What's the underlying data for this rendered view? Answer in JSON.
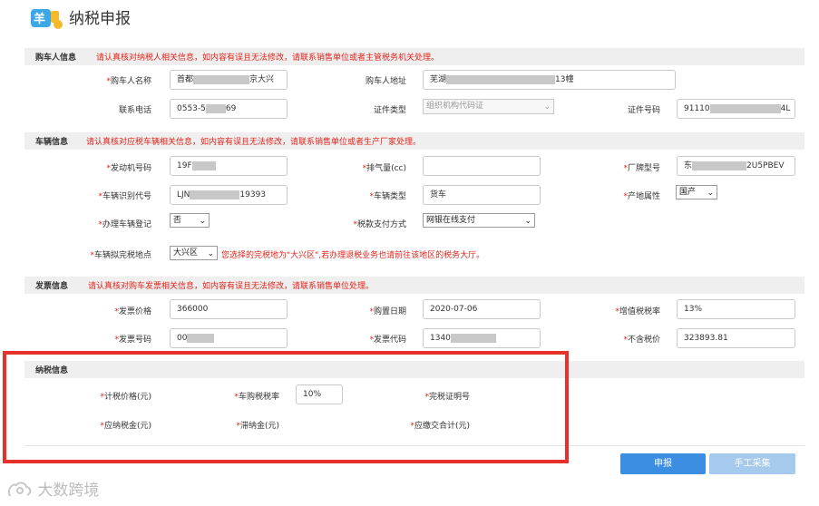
{
  "page": {
    "title": "纳税申报"
  },
  "sections": {
    "buyer": {
      "title": "购车人信息",
      "note": "请认真核对纳税人相关信息，如内容有误且无法修改，请联系销售单位或者主管税务机关处理。"
    },
    "vehicle": {
      "title": "车辆信息",
      "note": "请认真核对应税车辆相关信息，如内容有误且无法修改，请联系销售单位或者生产厂家处理。"
    },
    "invoice": {
      "title": "发票信息",
      "note": "请认真核对购车发票相关信息，如内容有误且无法修改，请联系销售单位处理。"
    },
    "tax": {
      "title": "纳税信息"
    }
  },
  "buyer": {
    "name_label": "购车人名称",
    "name_prefix": "首都",
    "name_suffix": "京大兴",
    "address_label": "购车人地址",
    "address_prefix": "芜湖",
    "address_suffix": "13幢",
    "phone_label": "联系电话",
    "phone_prefix": "0553-5",
    "phone_suffix": "69",
    "cert_type_label": "证件类型",
    "cert_type_value": "组织机构代码证",
    "cert_no_label": "证件号码",
    "cert_no_prefix": "91110",
    "cert_no_suffix": "4L"
  },
  "vehicle": {
    "engine_label": "发动机号码",
    "engine_prefix": "19F",
    "displacement_label": "排气量(cc)",
    "displacement_value": "",
    "model_label": "厂牌型号",
    "model_prefix": "东",
    "model_suffix": "2U5PBEV",
    "vin_label": "车辆识别代号",
    "vin_prefix": "LJN",
    "vin_suffix": "19393",
    "type_label": "车辆类型",
    "type_value": "货车",
    "origin_label": "产地属性",
    "origin_value": "国产",
    "register_label": "办理车辆登记",
    "register_value": "否",
    "payment_label": "税款支付方式",
    "payment_value": "网银在线支付",
    "location_label": "车辆拟完税地点",
    "location_value": "大兴区",
    "location_note": "您选择的完税地为\"大兴区\",若办理退税业务也请前往该地区的税务大厅。"
  },
  "invoice": {
    "price_label": "发票价格",
    "price_value": "366000",
    "date_label": "购置日期",
    "date_value": "2020-07-06",
    "vat_rate_label": "增值税税率",
    "vat_rate_value": "13%",
    "number_label": "发票号码",
    "number_prefix": "00",
    "code_label": "发票代码",
    "code_prefix": "1340",
    "excl_tax_label": "不含税价",
    "excl_tax_value": "323893.81"
  },
  "tax": {
    "taxable_price_label": "计税价格(元)",
    "rate_label": "车购税税率",
    "rate_value": "10%",
    "cert_label": "完税证明号",
    "payable_label": "应纳税金(元)",
    "late_fee_label": "滞纳金(元)",
    "total_label": "应缴交合计(元)"
  },
  "actions": {
    "submit_label": "申报",
    "manual_label": "手工采集"
  },
  "watermark": {
    "text": "大数跨境"
  },
  "colors": {
    "accent": "#3b8ee2",
    "required": "#e0241b",
    "highlight": "#e8312b",
    "section_bg": "#efefef"
  }
}
